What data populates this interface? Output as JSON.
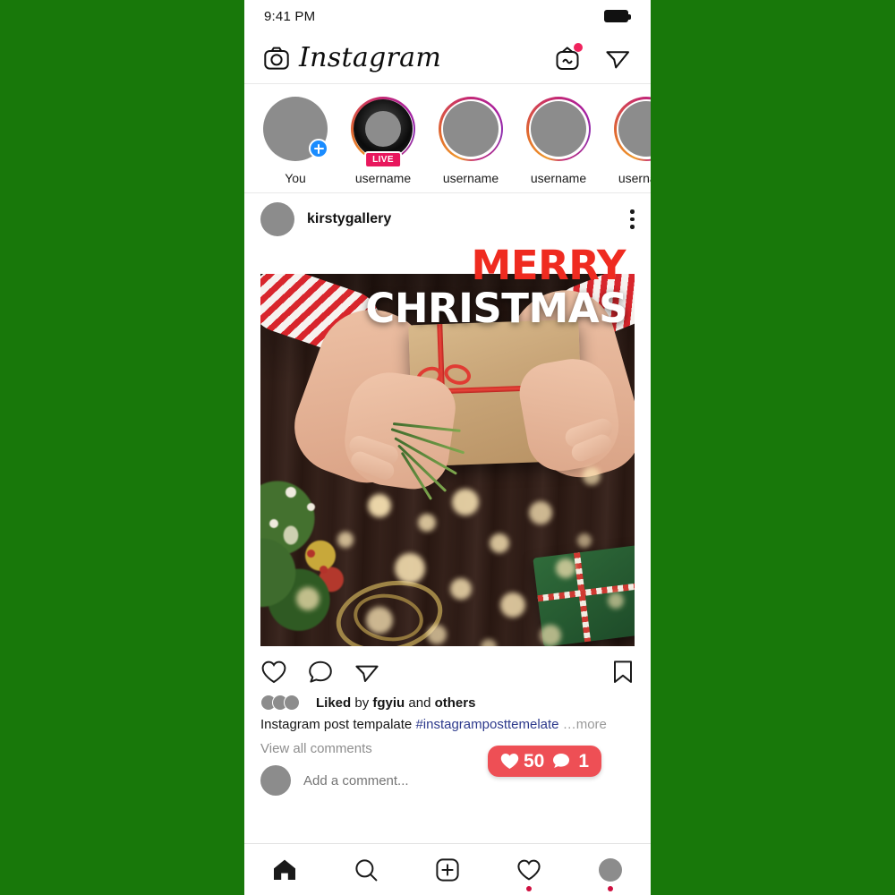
{
  "theme": {
    "page_background": "#18780a",
    "accent_blue": "#1a8cff",
    "live_badge": "#e8175d",
    "notification_red": "#ee4f55",
    "nav_dot": "#cf1040",
    "merry_red": "#ef2b20",
    "christmas_white": "#ffffff",
    "link_blue": "#2d3a8c"
  },
  "status_bar": {
    "time": "9:41 PM",
    "battery_icon": "battery-full-icon"
  },
  "top_nav": {
    "camera_icon": "camera-icon",
    "brand": "Instagram",
    "igtv_icon": "igtv-icon",
    "igtv_has_badge": true,
    "direct_message_icon": "paper-plane-icon"
  },
  "stories": {
    "items": [
      {
        "label": "You",
        "type": "own",
        "has_plus": true,
        "ring": "none"
      },
      {
        "label": "username",
        "type": "live",
        "badge": "LIVE",
        "ring": "gradient"
      },
      {
        "label": "username",
        "type": "story",
        "ring": "gradient"
      },
      {
        "label": "username",
        "type": "story",
        "ring": "gradient"
      },
      {
        "label": "username",
        "type": "story",
        "ring": "gradient"
      }
    ]
  },
  "post": {
    "username": "kirstygallery",
    "avatar": "user-avatar",
    "menu_icon": "more-options-icon",
    "image": {
      "headline_top": "MERRY",
      "headline_bottom": "CHRISTMAS",
      "description": "Hands holding a kraft paper wrapped gift with red twine on a dark wooden table with pine sprigs, wreath, bokeh lights and a green present"
    },
    "actions": {
      "like_icon": "heart-icon",
      "comment_icon": "comment-bubble-icon",
      "share_icon": "paper-plane-icon",
      "save_icon": "bookmark-icon"
    },
    "liked_by": {
      "prefix": "Liked",
      "by": "by",
      "username": "fgyiu",
      "and": "and",
      "others": "others",
      "full_text": "Liked by fgyiu and others"
    },
    "caption": {
      "text": "Instagram post tempalate ",
      "hashtag": "#instagramposttemelate",
      "more": "…more"
    },
    "view_comments": "View all comments",
    "comment_placeholder": "Add a comment..."
  },
  "notification_bubble": {
    "like_icon": "heart-filled-icon",
    "like_count": "50",
    "comment_icon": "comment-filled-icon",
    "comment_count": "1"
  },
  "bottom_nav": {
    "items": [
      {
        "name": "home",
        "icon": "home-icon",
        "active": true,
        "dot": false
      },
      {
        "name": "search",
        "icon": "search-icon",
        "active": false,
        "dot": false
      },
      {
        "name": "create",
        "icon": "plus-square-icon",
        "active": false,
        "dot": false
      },
      {
        "name": "activity",
        "icon": "heart-icon",
        "active": false,
        "dot": true
      },
      {
        "name": "profile",
        "icon": "profile-avatar",
        "active": false,
        "dot": true
      }
    ]
  }
}
